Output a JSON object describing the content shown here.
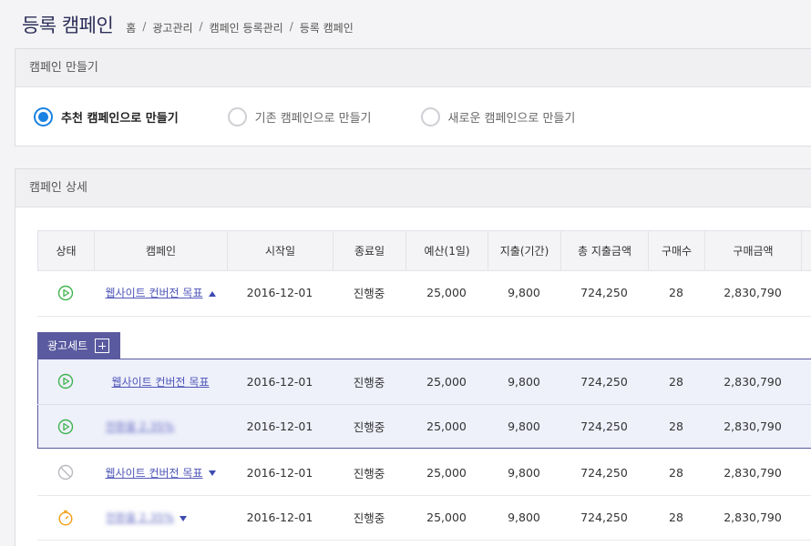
{
  "header": {
    "title": "등록 캠페인",
    "breadcrumb": [
      "홈",
      "광고관리",
      "캠페인 등록관리",
      "등록 캠페인"
    ]
  },
  "create_panel": {
    "title": "캠페인 만들기",
    "options": [
      {
        "label": "추천 캠페인으로 만들기",
        "selected": true
      },
      {
        "label": "기존 캠페인으로 만들기",
        "selected": false
      },
      {
        "label": "새로운 캠페인으로 만들기",
        "selected": false
      }
    ]
  },
  "detail_panel": {
    "title": "캠페인 상세",
    "columns": [
      "상태",
      "캠페인",
      "시작일",
      "종료일",
      "예산(1일)",
      "지출(기간)",
      "총 지출금액",
      "구매수",
      "구매금액"
    ],
    "adset_tab_label": "광고세트",
    "rows": {
      "main": {
        "status": "play-icon",
        "campaign": "웹사이트 컨버전 목표",
        "caret": "up",
        "start": "2016-12-01",
        "end": "진행중",
        "budget": "25,000",
        "spend": "9,800",
        "total": "724,250",
        "count": "28",
        "amount": "2,830,790"
      },
      "adset1": {
        "status": "play-icon",
        "campaign": "웹사이트 컨버전 목표",
        "start": "2016-12-01",
        "end": "진행중",
        "budget": "25,000",
        "spend": "9,800",
        "total": "724,250",
        "count": "28",
        "amount": "2,830,790"
      },
      "adset2": {
        "status": "play-icon",
        "campaign": "전환율 2.35%",
        "start": "2016-12-01",
        "end": "진행중",
        "budget": "25,000",
        "spend": "9,800",
        "total": "724,250",
        "count": "28",
        "amount": "2,830,790"
      },
      "row3": {
        "status": "stopped-icon",
        "campaign": "웹사이트 컨버전 목표",
        "caret": "down",
        "start": "2016-12-01",
        "end": "진행중",
        "budget": "25,000",
        "spend": "9,800",
        "total": "724,250",
        "count": "28",
        "amount": "2,830,790"
      },
      "row4": {
        "status": "timer-icon",
        "campaign": "전환율 2.35%",
        "caret": "down",
        "start": "2016-12-01",
        "end": "진행중",
        "budget": "25,000",
        "spend": "9,800",
        "total": "724,250",
        "count": "28",
        "amount": "2,830,790"
      }
    }
  },
  "colors": {
    "accent": "#1a82e2",
    "play": "#3fb34f",
    "timer": "#f39c12",
    "link": "#4f56b8",
    "adset": "#5a5aa0"
  }
}
